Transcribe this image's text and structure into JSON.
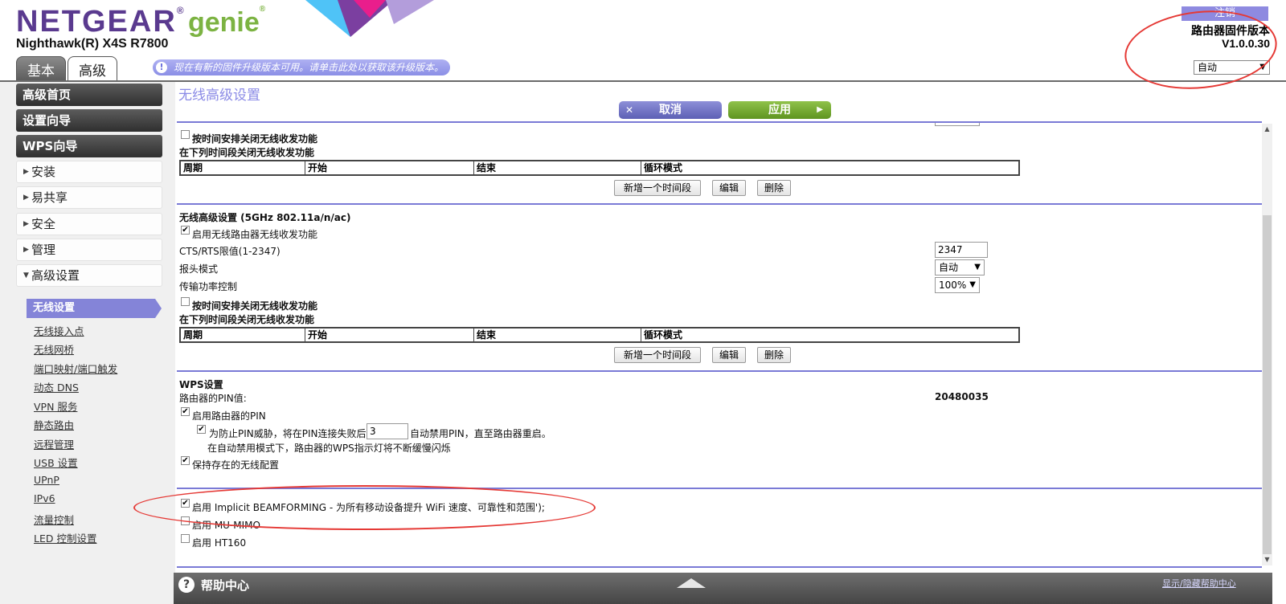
{
  "header": {
    "brand": "NETGEAR",
    "brand_sub": "genie",
    "model": "Nighthawk(R) X4S R7800",
    "tabs": [
      {
        "label": "基本"
      },
      {
        "label": "高级"
      }
    ],
    "notice": "现在有新的固件升级版本可用。请单击此处以获取该升级版本。",
    "logout": "注销",
    "firmware_title": "路由器固件版本",
    "firmware_version": "V1.0.0.30",
    "language": "自动"
  },
  "sidebar": {
    "dark_items": [
      {
        "label": "高级首页"
      },
      {
        "label": "设置向导"
      },
      {
        "label": "WPS向导"
      }
    ],
    "light_items": [
      {
        "label": "安装"
      },
      {
        "label": "易共享"
      },
      {
        "label": "安全"
      },
      {
        "label": "管理"
      },
      {
        "label": "高级设置"
      }
    ],
    "active_sub": "无线设置",
    "sub_items": [
      {
        "label": "无线接入点"
      },
      {
        "label": "无线网桥"
      },
      {
        "label": "端口映射/端口触发"
      },
      {
        "label": "动态 DNS"
      },
      {
        "label": "VPN 服务"
      },
      {
        "label": "静态路由"
      },
      {
        "label": "远程管理"
      },
      {
        "label": "USB 设置"
      },
      {
        "label": "UPnP"
      },
      {
        "label": "IPv6"
      },
      {
        "label": "流量控制"
      },
      {
        "label": "LED 控制设置"
      }
    ]
  },
  "main": {
    "title": "无线高级设置",
    "cancel": "取消",
    "apply": "应用",
    "schedule_checkbox": "按时间安排关闭无线收发功能",
    "schedule_caption": "在下列时间段关闭无线收发功能",
    "schedule_columns": [
      "周期",
      "开始",
      "结束",
      "循环模式"
    ],
    "add_period": "新增一个时间段",
    "edit": "编辑",
    "delete": "删除",
    "section_5g": "无线高级设置 (5GHz 802.11a/n/ac)",
    "enable_radio": "启用无线路由器无线收发功能",
    "cts_label": "CTS/RTS限值(1-2347)",
    "cts_value": "2347",
    "preamble_label": "报头模式",
    "preamble_value": "自动",
    "power_label": "传输功率控制",
    "power_value": "100%",
    "wps_title": "WPS设置",
    "pin_label": "路由器的PIN值:",
    "pin_value": "20480035",
    "enable_pin": "启用路由器的PIN",
    "pin_protect_pre": "为防止PIN威胁，将在PIN连接失败后",
    "pin_fail_count": "3",
    "pin_protect_post": "自动禁用PIN，直至路由器重启。",
    "pin_note": "在自动禁用模式下，路由器的WPS指示灯将不断缓慢闪烁",
    "keep_config": "保持存在的无线配置",
    "beamforming": "启用 Implicit BEAMFORMING - 为所有移动设备提升 WiFi 速度、可靠性和范围');",
    "mumimo": "启用 MU-MIMO",
    "ht160": "启用 HT160"
  },
  "footer": {
    "help": "帮助中心",
    "help_link": "显示/隐藏帮助中心"
  },
  "colors": {
    "brand_purple": "#5a3a8f",
    "genie_green": "#7cb342",
    "accent_purple": "#8484d8",
    "apply_green": "#6fa82f",
    "annotation_red": "#e53935"
  }
}
